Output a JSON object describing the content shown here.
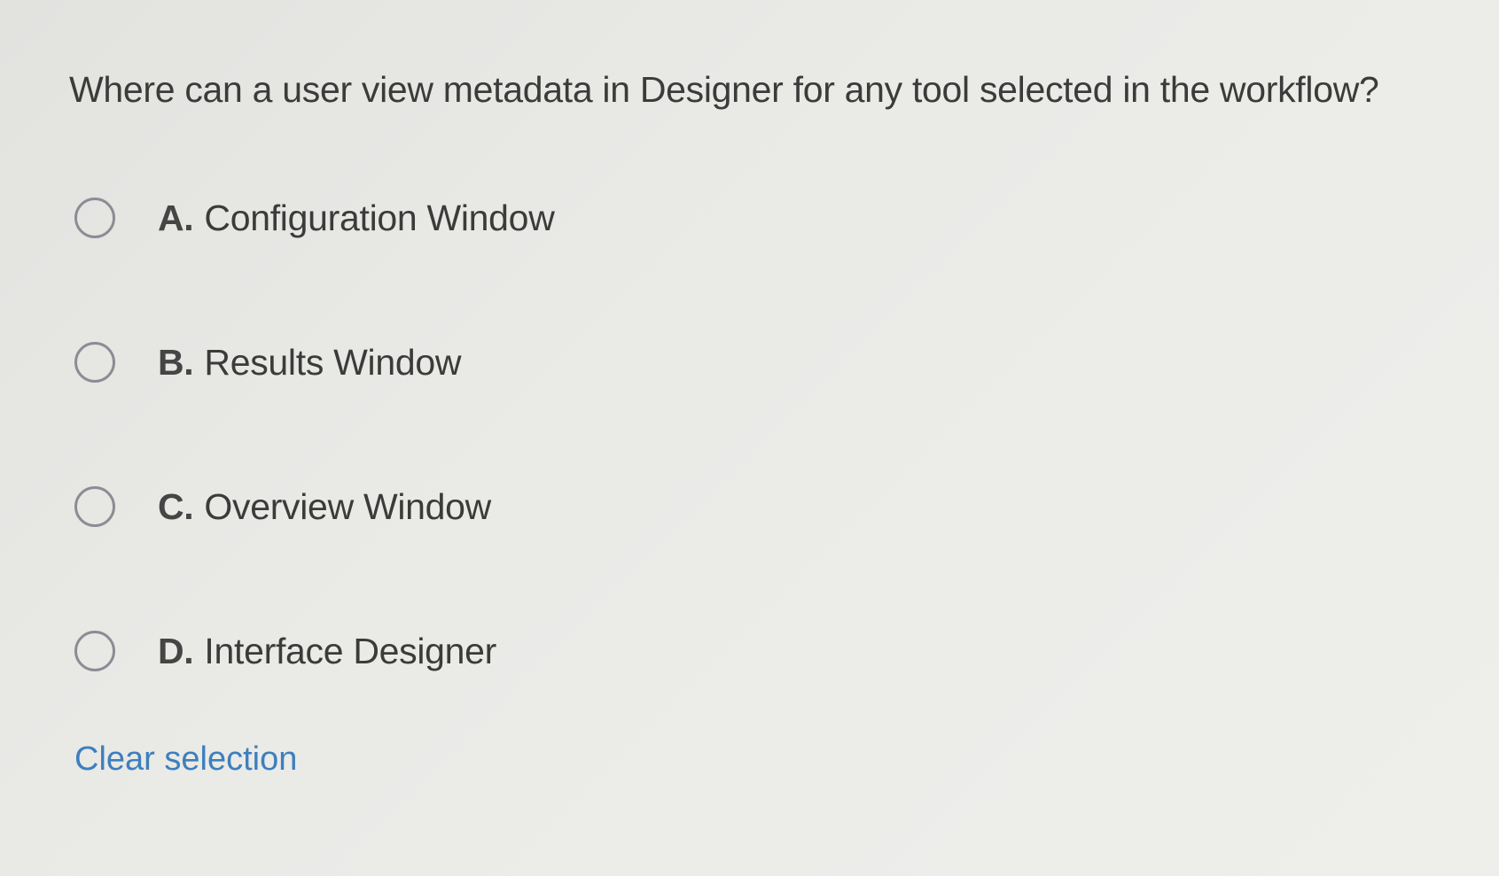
{
  "question": {
    "text": "Where can a user view metadata in Designer for any tool selected in the workflow?"
  },
  "options": [
    {
      "letter": "A.",
      "label": "Configuration Window"
    },
    {
      "letter": "B.",
      "label": "Results Window"
    },
    {
      "letter": "C.",
      "label": "Overview Window"
    },
    {
      "letter": "D.",
      "label": "Interface Designer"
    }
  ],
  "clear_selection": {
    "label": "Clear selection"
  },
  "colors": {
    "link": "#3d7fbd",
    "radio_border": "#8a8d93",
    "text": "#3b3b3b"
  }
}
